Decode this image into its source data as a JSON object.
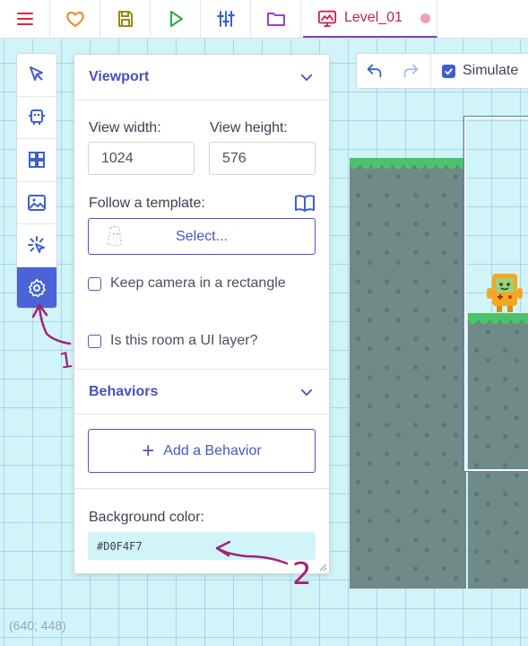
{
  "toolbar": {
    "buttons": [
      "menu-icon",
      "heart-icon",
      "save-icon",
      "play-icon",
      "sliders-icon",
      "folder-icon"
    ],
    "tab": {
      "label": "Level_01",
      "icon": "room-icon"
    },
    "colors": {
      "menu": "#e0243f",
      "heart": "#e9872a",
      "save": "#9a8a14",
      "play": "#2fa84f",
      "sliders": "#3a62c9",
      "folder": "#a03fc9",
      "tab": "#c2254a"
    }
  },
  "editbar": {
    "simulate_label": "Simulate",
    "simulate_checked": true
  },
  "tools": [
    "pointer-icon",
    "copy-icon",
    "grid-icon",
    "image-icon",
    "select-icon",
    "settings-icon"
  ],
  "panel": {
    "viewport_title": "Viewport",
    "view_width_label": "View width:",
    "view_width_value": "1024",
    "view_height_label": "View height:",
    "view_height_value": "576",
    "template_label": "Follow a template:",
    "select_label": "Select...",
    "keep_camera_label": "Keep camera in a rectangle",
    "ui_layer_label": "Is this room a UI layer?",
    "behaviors_title": "Behaviors",
    "add_behavior_label": "Add a Behavior",
    "bg_color_label": "Background color:",
    "bg_color_value": "#D0F4F7"
  },
  "coords": "(640; 448)",
  "annotations": {
    "one": "1",
    "two": "2",
    "color": "#a3217a"
  }
}
